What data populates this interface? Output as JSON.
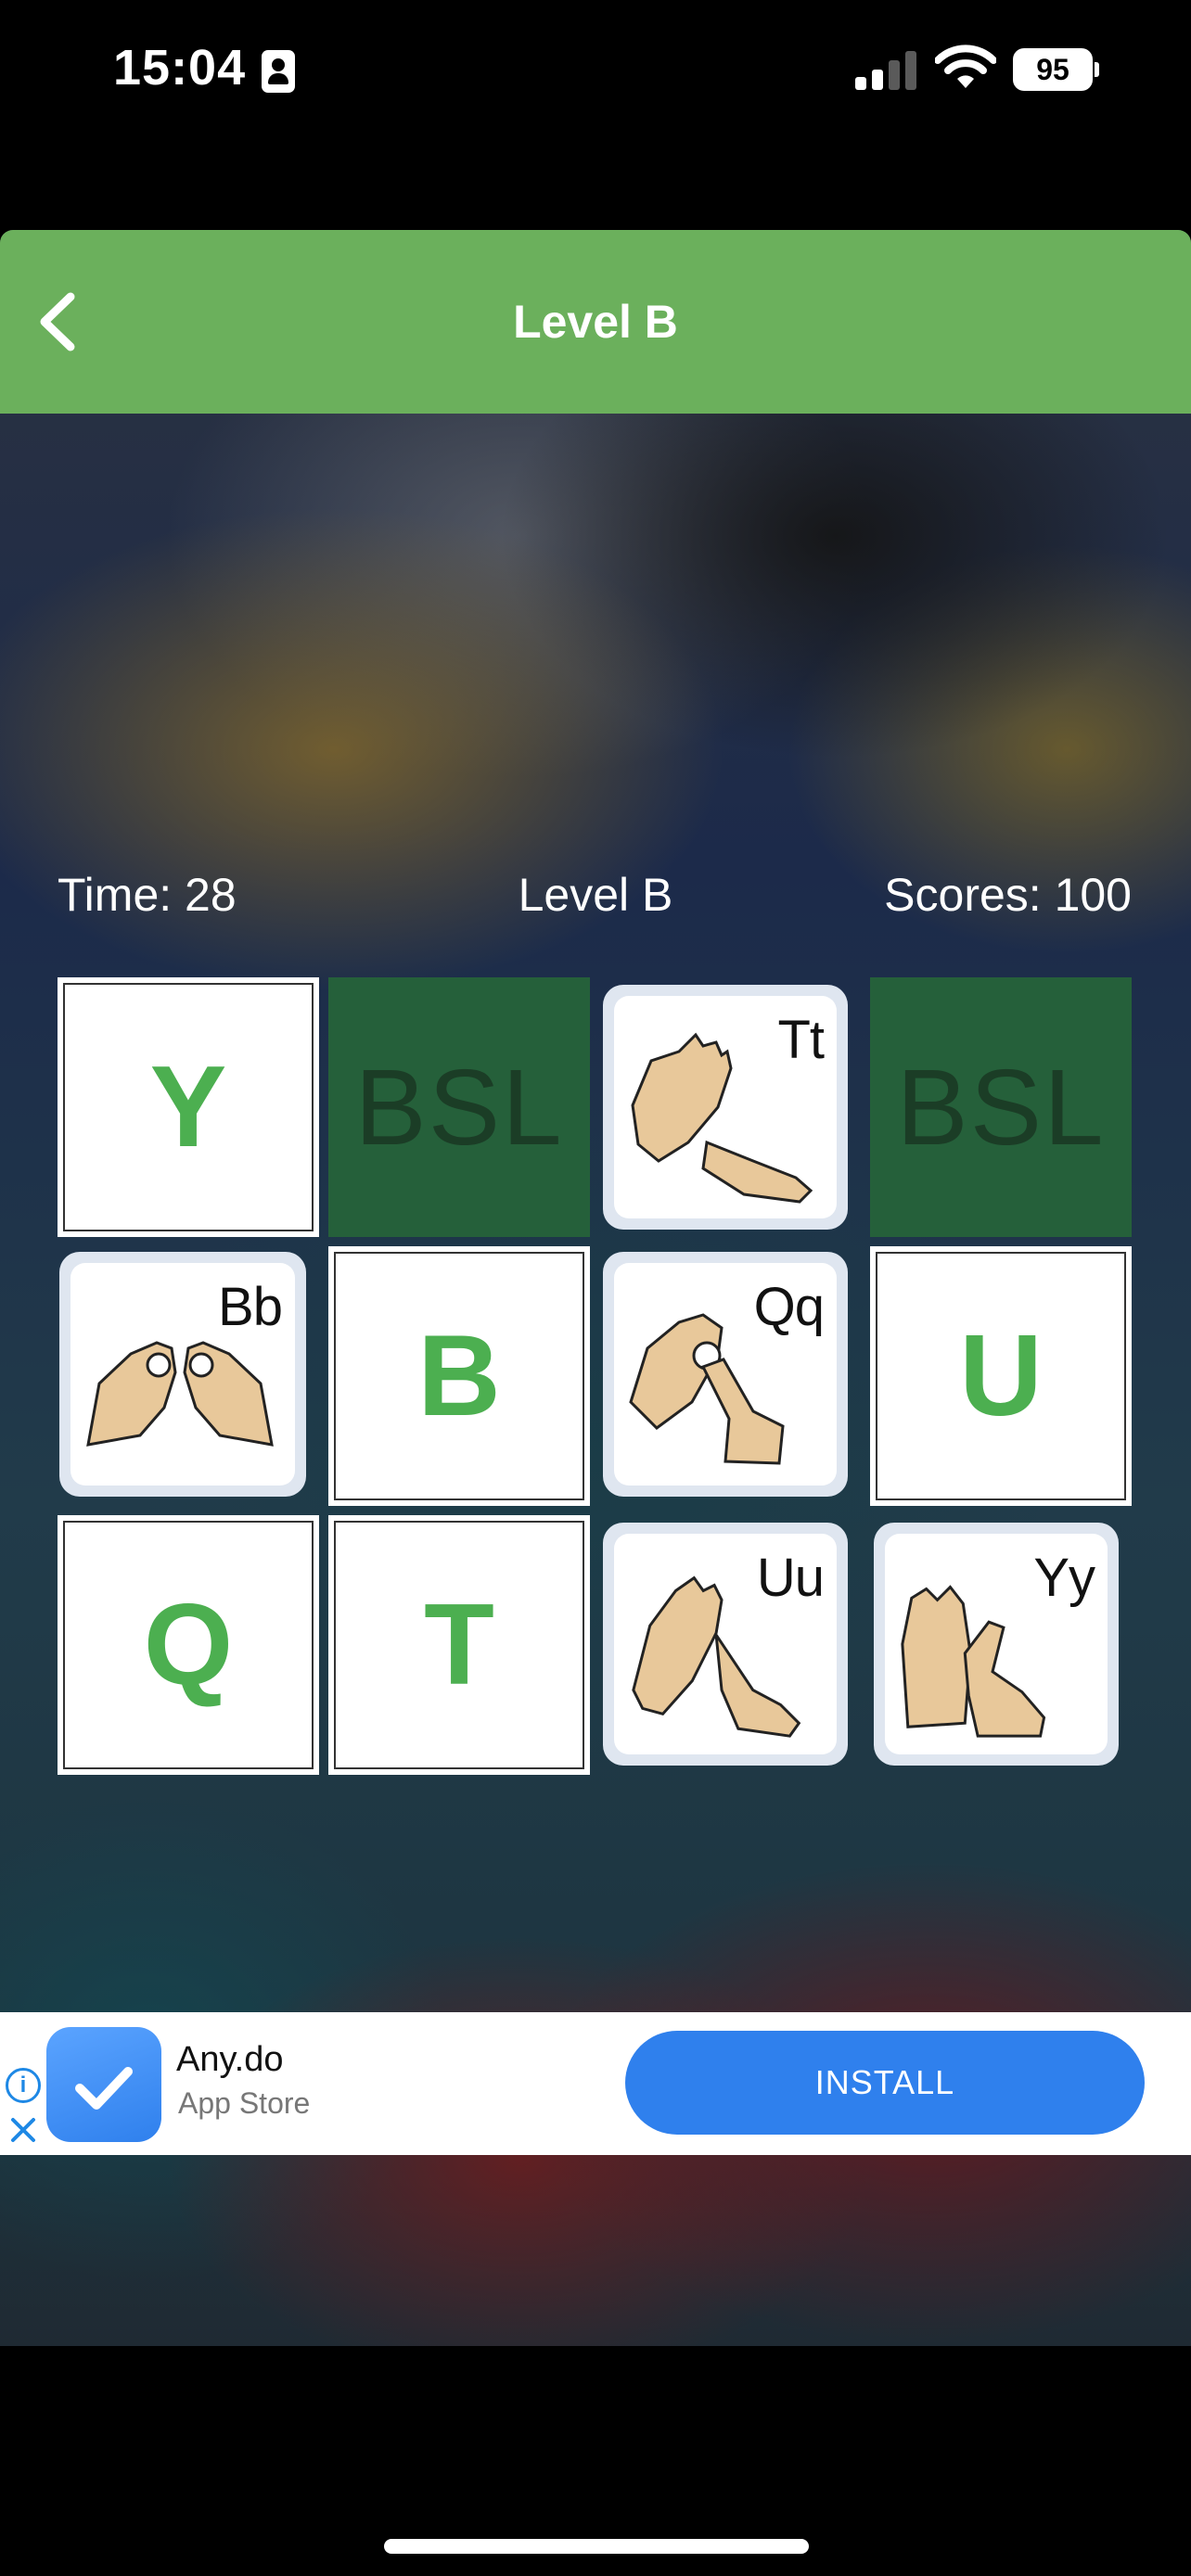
{
  "status_bar": {
    "time": "15:04",
    "battery": "95"
  },
  "header": {
    "title": "Level B"
  },
  "game": {
    "time_text": "Time: 28",
    "level_text": "Level B",
    "score_text": "Scores: 100"
  },
  "cards": [
    {
      "kind": "letter",
      "text": "Y"
    },
    {
      "kind": "back",
      "text": "BSL"
    },
    {
      "kind": "sign",
      "text": "Tt"
    },
    {
      "kind": "back",
      "text": "BSL"
    },
    {
      "kind": "sign",
      "text": "Bb"
    },
    {
      "kind": "letter",
      "text": "B"
    },
    {
      "kind": "sign",
      "text": "Qq"
    },
    {
      "kind": "letter",
      "text": "U"
    },
    {
      "kind": "letter",
      "text": "Q"
    },
    {
      "kind": "letter",
      "text": "T"
    },
    {
      "kind": "sign",
      "text": "Uu"
    },
    {
      "kind": "sign",
      "text": "Yy"
    }
  ],
  "ad": {
    "app_name": "Any.do",
    "store": "App Store",
    "install_label": "INSTALL"
  },
  "icons": {
    "back": "chevron-left-icon",
    "info": "info-icon",
    "close": "close-icon",
    "checkmark": "checkmark-icon"
  },
  "colors": {
    "header": "#6bb05c",
    "letter": "#4caf50",
    "card_back": "#25603a",
    "install": "#2f80ed"
  }
}
